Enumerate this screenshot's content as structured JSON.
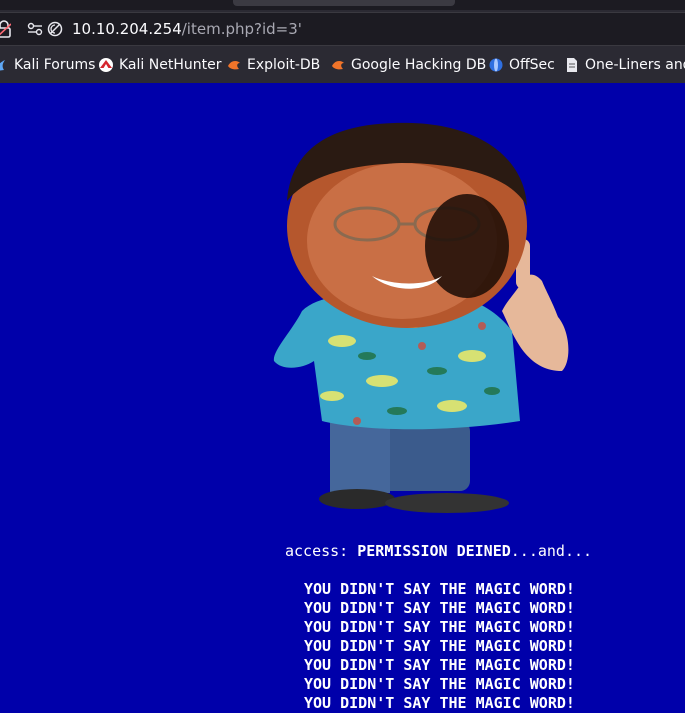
{
  "address_bar": {
    "host": "10.10.204.254",
    "path": "/item.php?id=3'"
  },
  "bookmarks": [
    {
      "label": "Kali Forums",
      "icon": "kali-dragon-icon"
    },
    {
      "label": "Kali NetHunter",
      "icon": "nethunter-icon"
    },
    {
      "label": "Exploit-DB",
      "icon": "exploit-db-icon"
    },
    {
      "label": "Google Hacking DB",
      "icon": "ghdb-icon"
    },
    {
      "label": "OffSec",
      "icon": "offsec-icon"
    },
    {
      "label": "One-Liners and",
      "icon": "document-icon"
    }
  ],
  "page": {
    "background": "#0000aa",
    "access_prefix": "access: ",
    "access_status": "PERMISSION DEINED",
    "access_suffix": "...and...",
    "magic_lines": [
      "YOU DIDN'T SAY THE MAGIC WORD!",
      "YOU DIDN'T SAY THE MAGIC WORD!",
      "YOU DIDN'T SAY THE MAGIC WORD!",
      "YOU DIDN'T SAY THE MAGIC WORD!",
      "YOU DIDN'T SAY THE MAGIC WORD!",
      "YOU DIDN'T SAY THE MAGIC WORD!",
      "YOU DIDN'T SAY THE MAGIC WORD!"
    ]
  }
}
